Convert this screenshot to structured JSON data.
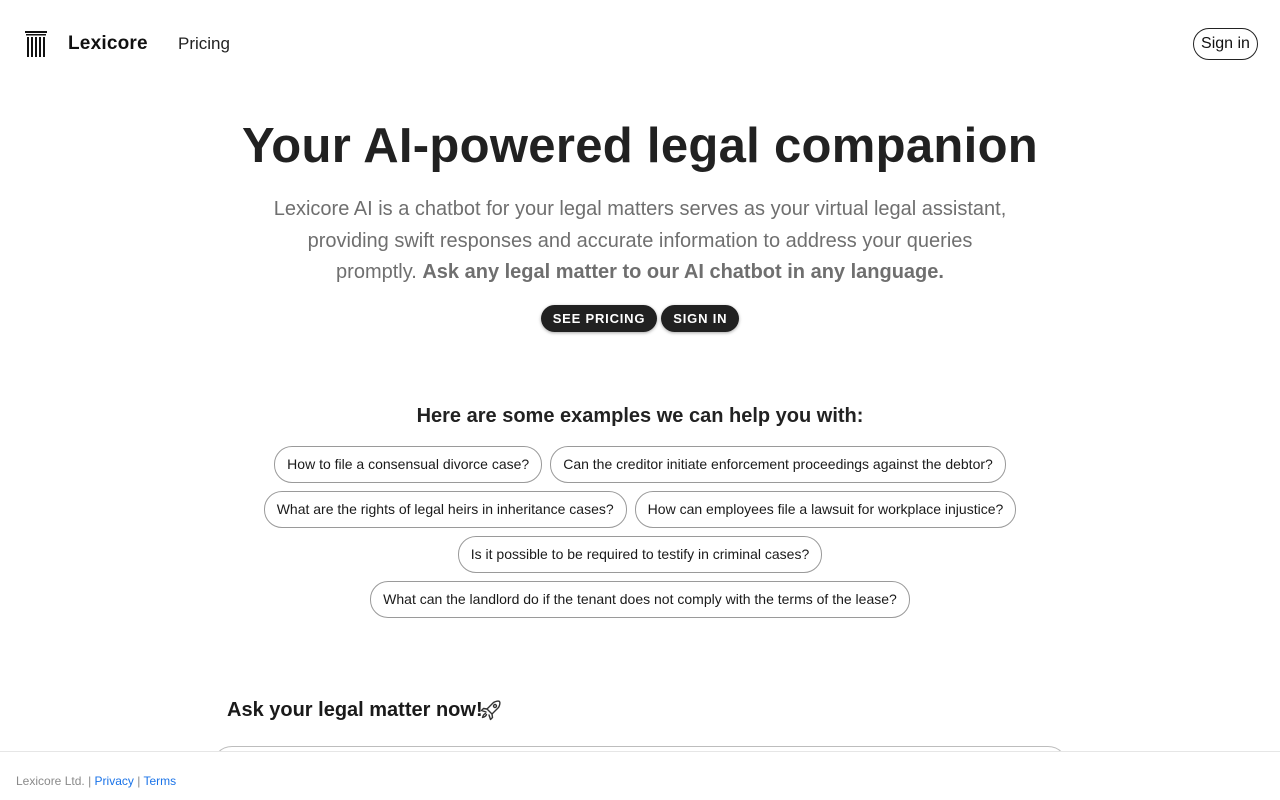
{
  "header": {
    "brand": "Lexicore",
    "nav_pricing": "Pricing",
    "signin_label": "Sign in",
    "logo_icon": "columns-logo-icon"
  },
  "hero": {
    "title": "Your AI-powered legal companion",
    "description": "Lexicore AI is a chatbot for your legal matters serves as your virtual legal assistant, providing swift responses and accurate information to address your queries promptly.",
    "description_bold": "Ask any legal matter to our AI chatbot in any language.",
    "cta_pricing": "SEE PRICING",
    "cta_signin": "SIGN IN"
  },
  "examples": {
    "heading": "Here are some examples we can help you with:",
    "items": [
      "How to file a consensual divorce case?",
      "Can the creditor initiate enforcement proceedings against the debtor?",
      "What are the rights of legal heirs in inheritance cases?",
      "How can employees file a lawsuit for workplace injustice?",
      "Is it possible to be required to testify in criminal cases?",
      "What can the landlord do if the tenant does not comply with the terms of the lease?"
    ]
  },
  "ask": {
    "heading": "Ask your legal matter now!",
    "icon": "rocket-icon"
  },
  "footer": {
    "company": "Lexicore Ltd.",
    "separator": "|",
    "privacy": "Privacy",
    "terms": "Terms"
  },
  "colors": {
    "text_dark": "#212121",
    "text_muted": "#6f6f6f",
    "button_bg": "#212121",
    "link": "#1a73e8"
  }
}
